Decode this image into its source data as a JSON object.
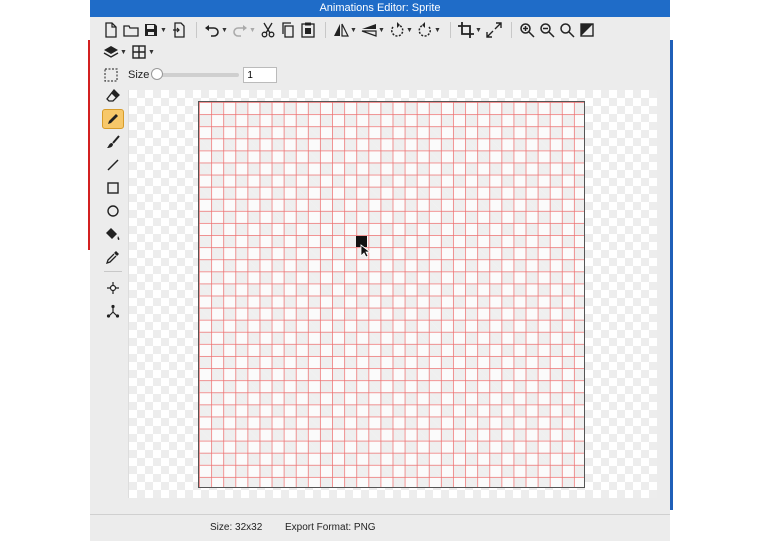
{
  "window": {
    "title": "Animations Editor: Sprite"
  },
  "toolbar": {
    "row1": [
      "new-file-icon",
      "open-folder-icon",
      "save-icon",
      "export-icon",
      "undo-icon",
      "redo-icon",
      "cut-icon",
      "copy-icon",
      "paste-icon",
      "flip-horizontal-icon",
      "flip-vertical-icon",
      "rotate-left-icon",
      "rotate-right-icon",
      "crop-icon",
      "resize-icon",
      "zoom-in-icon",
      "zoom-out-icon",
      "zoom-fit-icon",
      "invert-icon"
    ],
    "row2": [
      "layers-icon",
      "grid-icon"
    ],
    "size_label": "Size",
    "size_value": "1",
    "brush_size_level": 0.0
  },
  "tools": [
    "eraser-icon",
    "pencil-icon",
    "brush-icon",
    "line-icon",
    "rectangle-icon",
    "ellipse-icon",
    "fill-bucket-icon",
    "eyedropper-icon",
    "move-point-icon",
    "nodes-icon"
  ],
  "active_tool": "pencil-icon",
  "canvas": {
    "grid_columns": 32,
    "grid_rows": 32,
    "grid_color": "#ee6e6e",
    "pixel_color": "#111111"
  },
  "status": {
    "size": "Size: 32x32",
    "format": "Export Format: PNG"
  },
  "colors": {
    "titlebar": "#1f6cc8",
    "active_tool": "#f7c86a"
  }
}
